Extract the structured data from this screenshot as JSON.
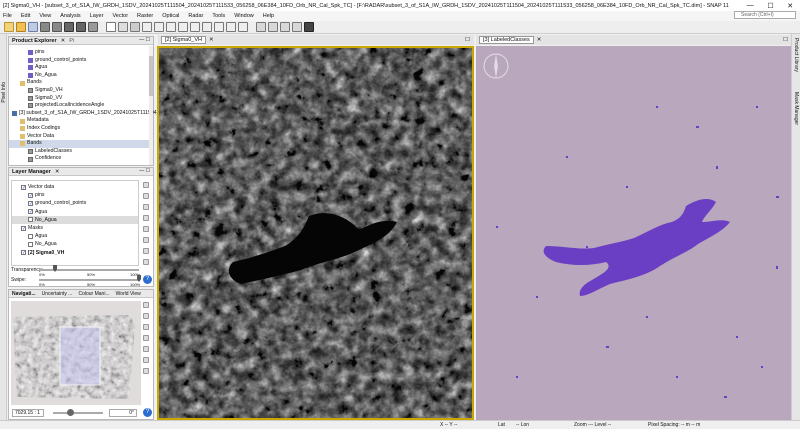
{
  "title": "[2] Sigma0_VH - [subset_3_of_S1A_IW_GRDH_1SDV_20241025T111504_20241025T111533_056258_06E384_10FD_Orb_NR_Cal_Spk_TC] - [F:\\RADAR\\subset_3_of_S1A_IW_GRDH_1SDV_20241025T111504_20241025T111533_056258_06E384_10FD_Orb_NR_Cal_Spk_TC.dim] - SNAP 11",
  "window_controls": {
    "minimize": "—",
    "maximize": "☐",
    "close": "✕"
  },
  "menu": [
    "File",
    "Edit",
    "View",
    "Analysis",
    "Layer",
    "Vector",
    "Raster",
    "Optical",
    "Radar",
    "Tools",
    "Window",
    "Help"
  ],
  "search_placeholder": "Search (Ctrl+I)",
  "left_tabs": [
    "Pixel Info"
  ],
  "right_tabs": [
    "Product Library",
    "Mask Manager"
  ],
  "product_explorer": {
    "title": "Product Explorer",
    "tab2": "Pi",
    "rows": [
      {
        "label": "pins",
        "icon": "vec",
        "indent": 2
      },
      {
        "label": "ground_control_points",
        "icon": "vec",
        "indent": 2
      },
      {
        "label": "Agua",
        "icon": "vec",
        "indent": 2
      },
      {
        "label": "No_Agua",
        "icon": "vec",
        "indent": 2
      },
      {
        "label": "Bands",
        "icon": "folder",
        "indent": 1
      },
      {
        "label": "Sigma0_VH",
        "icon": "band",
        "indent": 2
      },
      {
        "label": "Sigma0_VV",
        "icon": "band",
        "indent": 2
      },
      {
        "label": "projectedLocalIncidenceAngle",
        "icon": "band",
        "indent": 2
      },
      {
        "label": "[3] subset_3_of_S1A_IW_GRDH_1SDV_20241025T111504_202410",
        "icon": "img",
        "indent": 0
      },
      {
        "label": "Metadata",
        "icon": "folder",
        "indent": 1
      },
      {
        "label": "Index Codings",
        "icon": "folder",
        "indent": 1
      },
      {
        "label": "Vector Data",
        "icon": "folder",
        "indent": 1
      },
      {
        "label": "Bands",
        "icon": "folder",
        "indent": 1
      },
      {
        "label": "LabeledClasses",
        "icon": "band",
        "indent": 2
      },
      {
        "label": "Confidence",
        "icon": "band",
        "indent": 2
      }
    ]
  },
  "layer_manager": {
    "title": "Layer Manager",
    "rows": [
      {
        "label": "Vector data",
        "indent": 1,
        "checked": true
      },
      {
        "label": "pins",
        "indent": 2,
        "checked": true
      },
      {
        "label": "ground_control_points",
        "indent": 2,
        "checked": true
      },
      {
        "label": "Agua",
        "indent": 2,
        "checked": true
      },
      {
        "label": "No_Agua",
        "indent": 2,
        "checked": false
      },
      {
        "label": "Masks",
        "indent": 1,
        "checked": true
      },
      {
        "label": "Agua",
        "indent": 2,
        "checked": false
      },
      {
        "label": "No_Agua",
        "indent": 2,
        "checked": false
      },
      {
        "label": "[2] Sigma0_VH",
        "indent": 1,
        "checked": true
      }
    ],
    "transparency_label": "Transparency:",
    "swipe_label": "Swipe:",
    "ticks": [
      "0%",
      "50%",
      "100%"
    ]
  },
  "nav_tabs": [
    "Navigati...",
    "Uncertainty ...",
    "Colour Mani...",
    "World View"
  ],
  "nav": {
    "scale_value": "7029.15 : 1",
    "rotation_value": "0°"
  },
  "views": [
    {
      "label": "[2] Sigma0_VH"
    },
    {
      "label": "[3] LabeledClasses"
    }
  ],
  "status": {
    "xy": "X -- Y --",
    "lat": "Lat",
    "lon": "-- Lon",
    "zoom": "Zoom --- Level --",
    "pixel": "Pixel Spacing: -- m -- m"
  },
  "colors": {
    "classified_bg": "#b9a7bd",
    "water": "#6a3fc4",
    "active_border": "#c8a800"
  }
}
